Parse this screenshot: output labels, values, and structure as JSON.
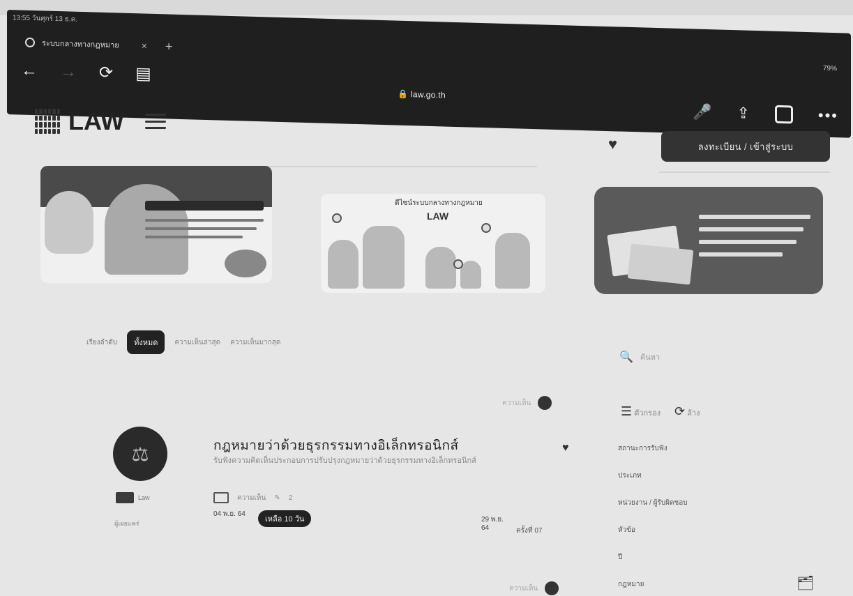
{
  "browser": {
    "status_left": "13:55 วันศุกร์ 13 ธ.ค.",
    "battery": "79%",
    "tab_title": "ระบบกลางทางกฎหมาย",
    "tab_close": "×",
    "tab_new": "+",
    "url": "law.go.th",
    "nav_back": "←",
    "nav_forward": "→",
    "nav_reload": "⟳",
    "nav_reader": "▤",
    "mic": "🎤",
    "share": "⇪",
    "more": "•••"
  },
  "header": {
    "logo_text": "LAW",
    "login_label": "ลงทะเบียน / เข้าสู่ระบบ",
    "heart": "♥"
  },
  "banners": {
    "b2_caption": "ดีไซน์ระบบกลางทางกฎหมาย",
    "b2_brand": "LAW"
  },
  "filters": {
    "label": "เรียงลำดับ",
    "active": "ทั้งหมด",
    "item2": "ความเห็นล่าสุด",
    "item3": "ความเห็นมากสุด"
  },
  "search": {
    "icon": "🔍",
    "placeholder": "ค้นหา"
  },
  "side": {
    "filter_label": "ตัวกรอง",
    "refresh_label": "ล้าง",
    "items": [
      "สถานะการรับฟัง",
      "ประเภท",
      "หน่วยงาน / ผู้รับผิดชอบ",
      "หัวข้อ",
      "ปี",
      "กฎหมาย"
    ],
    "folder": "🗂"
  },
  "post": {
    "top_meta": "ความเห็น",
    "title": "กฎหมายว่าด้วยธุรกรรมทางอิเล็กทรอนิกส์",
    "description": "รับฟังความคิดเห็นประกอบการปรับปรุงกฎหมายว่าด้วยธุรกรรมทางอิเล็กทรอนิกส์",
    "stat_views": "ความเห็น",
    "stat_edits": "2",
    "date_start": "04 พ.ย. 64",
    "remaining_badge": "เหลือ 10 วัน",
    "date_end": "29 พ.ย. 64",
    "times_label": "ครั้งที่ 07",
    "author_badge": "Law",
    "author_meta": "ผู้เผยแพร่",
    "bottom_meta": "ความเห็น"
  }
}
